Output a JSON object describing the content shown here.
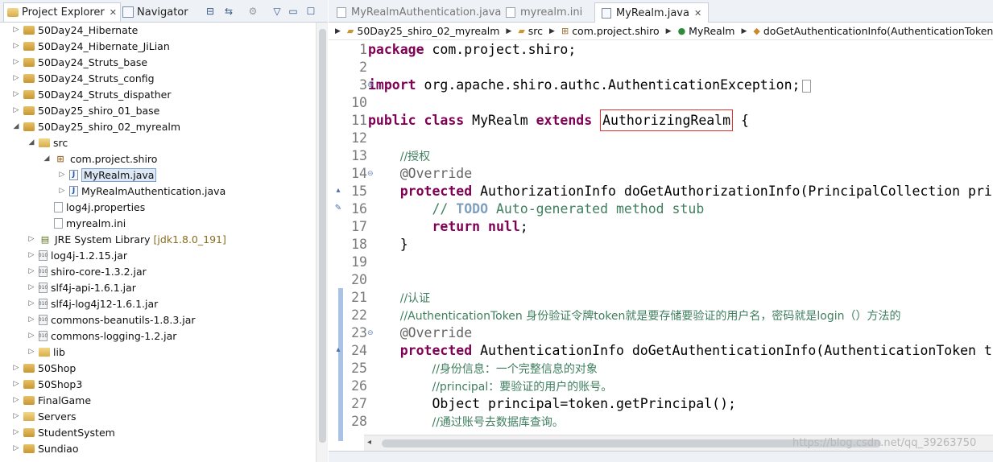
{
  "left_panel": {
    "tabs": [
      {
        "label": "Project Explorer",
        "close": "✕"
      },
      {
        "label": "Navigator"
      }
    ],
    "tree": [
      {
        "label": "50Day24_Hibernate",
        "icon": "project-icon",
        "arrow": "▷",
        "indent": 0
      },
      {
        "label": "50Day24_Hibernate_JiLian",
        "icon": "project-icon",
        "arrow": "▷",
        "indent": 0
      },
      {
        "label": "50Day24_Struts_base",
        "icon": "project-icon",
        "arrow": "▷",
        "indent": 0
      },
      {
        "label": "50Day24_Struts_config",
        "icon": "project-icon",
        "arrow": "▷",
        "indent": 0
      },
      {
        "label": "50Day24_Struts_dispather",
        "icon": "project-icon",
        "arrow": "▷",
        "indent": 0
      },
      {
        "label": "50Day25_shiro_01_base",
        "icon": "project-icon",
        "arrow": "▷",
        "indent": 0
      },
      {
        "label": "50Day25_shiro_02_myrealm",
        "icon": "project-icon",
        "arrow": "◢",
        "indent": 0
      },
      {
        "label": "src",
        "icon": "source-folder-icon",
        "arrow": "◢",
        "indent": 1
      },
      {
        "label": "com.project.shiro",
        "icon": "package-icon",
        "arrow": "◢",
        "indent": 2
      },
      {
        "label": "MyRealm.java",
        "icon": "java-file-icon",
        "arrow": "▷",
        "indent": 3,
        "selected": true
      },
      {
        "label": "MyRealmAuthentication.java",
        "icon": "java-file-icon",
        "arrow": "▷",
        "indent": 3
      },
      {
        "label": "log4j.properties",
        "icon": "file-icon",
        "arrow": "",
        "indent": 2
      },
      {
        "label": "myrealm.ini",
        "icon": "file-icon",
        "arrow": "",
        "indent": 2
      },
      {
        "label": "JRE System Library",
        "sub": "[jdk1.8.0_191]",
        "icon": "library-icon",
        "arrow": "▷",
        "indent": 1
      },
      {
        "label": "log4j-1.2.15.jar",
        "icon": "jar-icon",
        "arrow": "▷",
        "indent": 1
      },
      {
        "label": "shiro-core-1.3.2.jar",
        "icon": "jar-icon",
        "arrow": "▷",
        "indent": 1
      },
      {
        "label": "slf4j-api-1.6.1.jar",
        "icon": "jar-icon",
        "arrow": "▷",
        "indent": 1
      },
      {
        "label": "slf4j-log4j12-1.6.1.jar",
        "icon": "jar-icon",
        "arrow": "▷",
        "indent": 1
      },
      {
        "label": "commons-beanutils-1.8.3.jar",
        "icon": "jar-icon",
        "arrow": "▷",
        "indent": 1
      },
      {
        "label": "commons-logging-1.2.jar",
        "icon": "jar-icon",
        "arrow": "▷",
        "indent": 1
      },
      {
        "label": "lib",
        "icon": "folder-icon",
        "arrow": "▷",
        "indent": 1
      },
      {
        "label": "50Shop",
        "icon": "project-icon",
        "arrow": "▷",
        "indent": 0
      },
      {
        "label": "50Shop3",
        "icon": "project-icon",
        "arrow": "▷",
        "indent": 0
      },
      {
        "label": "FinalGame",
        "icon": "project-icon",
        "arrow": "▷",
        "indent": 0
      },
      {
        "label": "Servers",
        "icon": "folder-icon",
        "arrow": "▷",
        "indent": 0
      },
      {
        "label": "StudentSystem",
        "icon": "project-icon",
        "arrow": "▷",
        "indent": 0
      },
      {
        "label": "Sundiao",
        "icon": "project-icon",
        "arrow": "▷",
        "indent": 0
      }
    ]
  },
  "editor": {
    "tabs": [
      {
        "label": "MyRealmAuthentication.java"
      },
      {
        "label": "myrealm.ini"
      },
      {
        "label": "MyRealm.java",
        "close": "✕"
      }
    ],
    "breadcrumb": [
      "50Day25_shiro_02_myrealm",
      "src",
      "com.project.shiro",
      "MyRealm",
      "doGetAuthenticationInfo(AuthenticationToken) : A"
    ],
    "lines": [
      {
        "n": "1",
        "parts": [
          [
            "kw",
            "package"
          ],
          [
            "",
            " com.project.shiro;"
          ]
        ]
      },
      {
        "n": "2",
        "parts": []
      },
      {
        "n": "3",
        "parts": [
          [
            "kw",
            "import"
          ],
          [
            "",
            " org.apache.shiro.authc.AuthenticationException;"
          ]
        ],
        "fold": "⊕",
        "dotbox": true
      },
      {
        "n": "10",
        "parts": []
      },
      {
        "n": "11",
        "parts": [
          [
            "kw",
            "public"
          ],
          [
            "",
            " "
          ],
          [
            "kw",
            "class"
          ],
          [
            "",
            " MyRealm "
          ],
          [
            "kw",
            "extends"
          ],
          [
            "",
            " "
          ],
          [
            "box",
            "AuthorizingRealm"
          ],
          [
            "",
            " {"
          ]
        ]
      },
      {
        "n": "12",
        "parts": []
      },
      {
        "n": "13",
        "parts": [
          [
            "",
            "    "
          ],
          [
            "cm",
            "//授权"
          ]
        ]
      },
      {
        "n": "14",
        "parts": [
          [
            "",
            "    "
          ],
          [
            "an",
            "@Override"
          ]
        ],
        "fold": "⊖"
      },
      {
        "n": "15",
        "parts": [
          [
            "",
            "    "
          ],
          [
            "kw",
            "protected"
          ],
          [
            "",
            " AuthorizationInfo doGetAuthorizationInfo(PrincipalCollection pri"
          ]
        ]
      },
      {
        "n": "16",
        "parts": [
          [
            "",
            "        "
          ],
          [
            "cm",
            "// "
          ],
          [
            "todo",
            "TODO"
          ],
          [
            "cm",
            " Auto-generated method stub"
          ]
        ]
      },
      {
        "n": "17",
        "parts": [
          [
            "",
            "        "
          ],
          [
            "kw",
            "return"
          ],
          [
            "",
            " "
          ],
          [
            "kw",
            "null"
          ],
          [
            "",
            ";"
          ]
        ]
      },
      {
        "n": "18",
        "parts": [
          [
            "",
            "    }"
          ]
        ]
      },
      {
        "n": "19",
        "parts": []
      },
      {
        "n": "20",
        "parts": []
      },
      {
        "n": "21",
        "parts": [
          [
            "",
            "    "
          ],
          [
            "cm",
            "//认证"
          ]
        ]
      },
      {
        "n": "22",
        "parts": [
          [
            "",
            "    "
          ],
          [
            "cm",
            "//AuthenticationToken 身份验证令牌token就是要存储要验证的用户名，密码就是login（）方法的"
          ]
        ]
      },
      {
        "n": "23",
        "parts": [
          [
            "",
            "    "
          ],
          [
            "an",
            "@Override"
          ]
        ],
        "fold": "⊖"
      },
      {
        "n": "24",
        "parts": [
          [
            "",
            "    "
          ],
          [
            "kw",
            "protected"
          ],
          [
            "",
            " AuthenticationInfo doGetAuthenticationInfo(AuthenticationToken t"
          ]
        ]
      },
      {
        "n": "25",
        "parts": [
          [
            "",
            "        "
          ],
          [
            "cm",
            "//身份信息：一个完整信息的对象"
          ]
        ]
      },
      {
        "n": "26",
        "parts": [
          [
            "",
            "        "
          ],
          [
            "cm",
            "//principal：要验证的用户的账号。"
          ]
        ]
      },
      {
        "n": "27",
        "parts": [
          [
            "",
            "        Object principal=token.getPrincipal();"
          ]
        ]
      },
      {
        "n": "28",
        "parts": [
          [
            "",
            "        "
          ],
          [
            "cm",
            "//通过账号去数据库查询。"
          ]
        ]
      }
    ]
  },
  "watermark": "https://blog.csdn.net/qq_39263750"
}
